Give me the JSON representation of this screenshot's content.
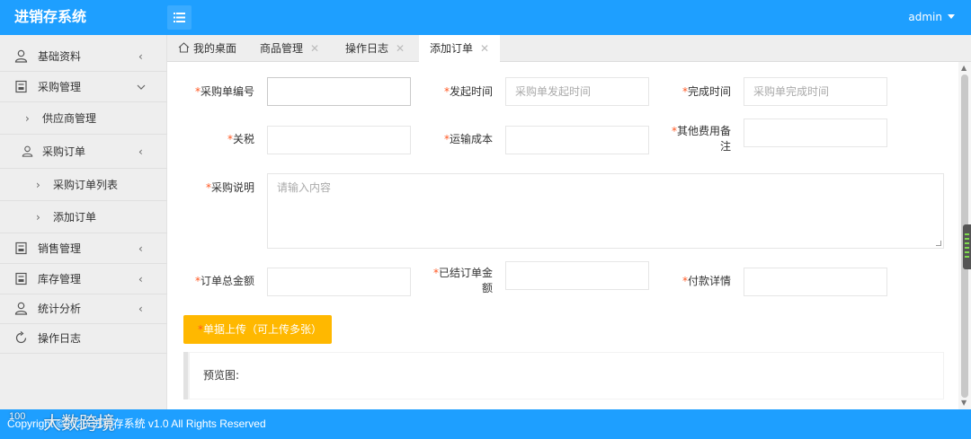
{
  "header": {
    "title": "进销存系统",
    "user": "admin"
  },
  "sidebar": {
    "items": [
      {
        "label": "基础资料",
        "icon": "user-icon"
      },
      {
        "label": "采购管理",
        "icon": "document-icon"
      },
      {
        "label": "供应商管理"
      },
      {
        "label": "采购订单",
        "icon": "user-icon"
      },
      {
        "label": "采购订单列表"
      },
      {
        "label": "添加订单"
      },
      {
        "label": "销售管理",
        "icon": "document-icon"
      },
      {
        "label": "库存管理",
        "icon": "document-icon"
      },
      {
        "label": "统计分析",
        "icon": "user-icon"
      },
      {
        "label": "操作日志",
        "icon": "refresh-icon"
      }
    ]
  },
  "tabs": {
    "home": "我的桌面",
    "items": [
      "商品管理",
      "操作日志",
      "添加订单"
    ],
    "active": "添加订单"
  },
  "form": {
    "required_mark": "*",
    "order_no": {
      "label": "采购单编号",
      "value": ""
    },
    "start_time": {
      "label": "发起时间",
      "placeholder": "采购单发起时间"
    },
    "finish_time": {
      "label": "完成时间",
      "placeholder": "采购单完成时间"
    },
    "tariff": {
      "label": "关税",
      "value": ""
    },
    "shipping_cost": {
      "label": "运输成本",
      "value": ""
    },
    "other_fee_note": {
      "label_line1": "其他费用备",
      "label_line2": "注",
      "value": ""
    },
    "description": {
      "label": "采购说明",
      "placeholder": "请输入内容"
    },
    "total_amount": {
      "label": "订单总金额",
      "value": ""
    },
    "settled_amount": {
      "label_line1": "已结订单金",
      "label_line2": "额",
      "value": ""
    },
    "payment_details": {
      "label": "付款详情",
      "value": ""
    },
    "upload_button": "单据上传（可上传多张）",
    "preview_label": "预览图:"
  },
  "footer": {
    "copyright": "Copyright ©2020 进销存系统 v1.0 All Rights Reserved",
    "watermark": "大数跨境",
    "watermark_logo": "100"
  },
  "colors": {
    "primary": "#1e9fff",
    "warning": "#ffb800",
    "required": "#ff5722"
  }
}
